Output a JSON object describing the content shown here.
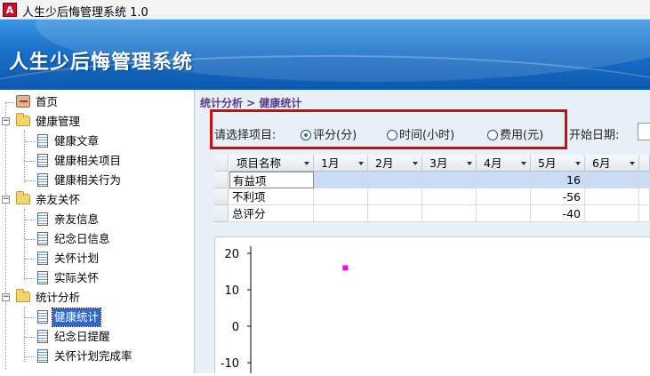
{
  "window": {
    "title": "人生少后悔管理系统 1.0",
    "icon_letter": "A"
  },
  "banner": {
    "title": "人生少后悔管理系统"
  },
  "sidebar": {
    "home": "首页",
    "groups": [
      {
        "label": "健康管理",
        "items": [
          "健康文章",
          "健康相关项目",
          "健康相关行为"
        ]
      },
      {
        "label": "亲友关怀",
        "items": [
          "亲友信息",
          "纪念日信息",
          "关怀计划",
          "实际关怀"
        ]
      },
      {
        "label": "统计分析",
        "items": [
          "健康统计",
          "纪念日提醒",
          "关怀计划完成率"
        ]
      }
    ],
    "selected": "健康统计"
  },
  "breadcrumb": "统计分析 > 健康统计",
  "filters": {
    "select_label": "请选择项目:",
    "options": [
      "评分(分)",
      "时间(小时)",
      "费用(元)"
    ],
    "selected_option": "评分(分)",
    "start_date_label": "开始日期:",
    "start_date_value": ""
  },
  "grid": {
    "columns": [
      "项目名称",
      "1月",
      "2月",
      "3月",
      "4月",
      "5月",
      "6月"
    ],
    "rows": [
      {
        "name": "有益项",
        "may": "16"
      },
      {
        "name": "不利项",
        "may": "-56"
      },
      {
        "name": "总评分",
        "may": "-40"
      }
    ]
  },
  "chart_data": {
    "type": "scatter",
    "y_ticks": [
      "20",
      "10",
      "0",
      "-10"
    ],
    "ylim": [
      -15,
      20
    ],
    "series": [
      {
        "color": "#ff00ff",
        "points": [
          {
            "x": 2.9,
            "y": 16
          }
        ]
      }
    ],
    "xlim": [
      0,
      12
    ]
  }
}
